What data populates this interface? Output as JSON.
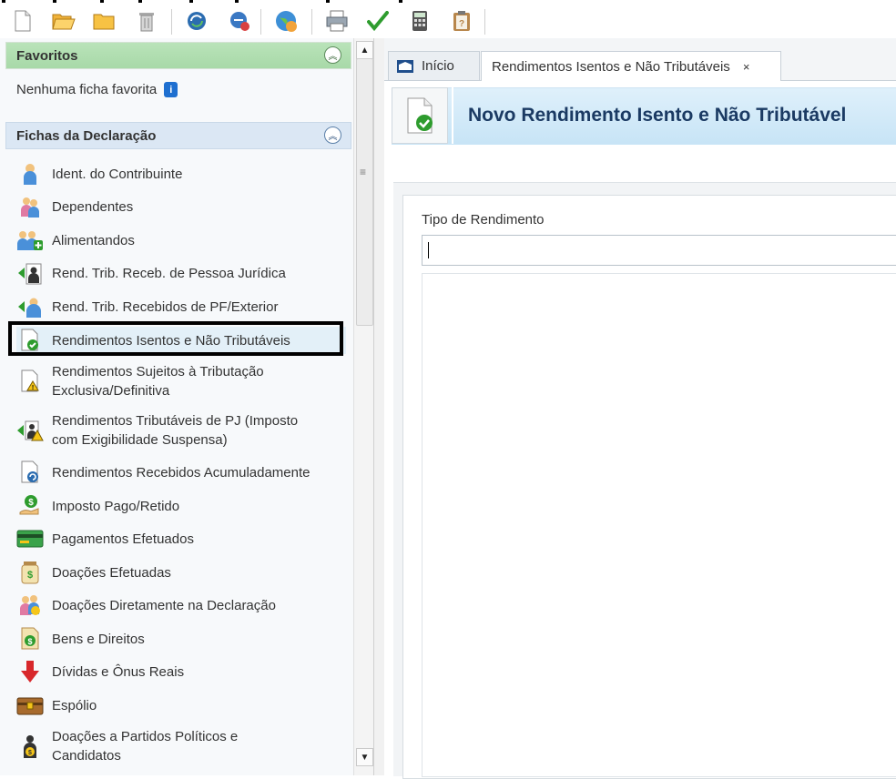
{
  "toolbar": {
    "buttons": [
      "new-file-icon",
      "open-folder-icon",
      "folder-icon",
      "trash-icon",
      "sync-icon",
      "recover-icon",
      "globe-icon",
      "print-icon",
      "check-icon",
      "calculator-icon",
      "clipboard-icon"
    ]
  },
  "sidebar": {
    "favoritos": {
      "title": "Favoritos",
      "empty_text": "Nenhuma ficha favorita"
    },
    "fichas": {
      "title": "Fichas da Declaração",
      "items": [
        {
          "label": "Ident. do Contribuinte",
          "icon": "person-icon"
        },
        {
          "label": "Dependentes",
          "icon": "dependents-icon"
        },
        {
          "label": "Alimentandos",
          "icon": "alimentandos-icon"
        },
        {
          "label": "Rend. Trib. Receb. de Pessoa Jurídica",
          "icon": "income-pj-icon"
        },
        {
          "label": "Rend. Trib. Recebidos de PF/Exterior",
          "icon": "income-pf-icon"
        },
        {
          "label": "Rendimentos Isentos e Não Tributáveis",
          "icon": "document-check-icon"
        },
        {
          "label_l1": "Rendimentos Sujeitos à Tributação",
          "label_l2": "Exclusiva/Definitiva",
          "icon": "document-warning-icon"
        },
        {
          "label_l1": "Rendimentos Tributáveis de PJ (Imposto",
          "label_l2": "com Exigibilidade Suspensa)",
          "icon": "income-suspended-icon"
        },
        {
          "label": "Rendimentos Recebidos Acumuladamente",
          "icon": "document-refresh-icon"
        },
        {
          "label": "Imposto Pago/Retido",
          "icon": "tax-paid-icon"
        },
        {
          "label": "Pagamentos Efetuados",
          "icon": "card-icon"
        },
        {
          "label": "Doações Efetuadas",
          "icon": "donation-jar-icon"
        },
        {
          "label": "Doações Diretamente na Declaração",
          "icon": "donation-people-icon"
        },
        {
          "label": "Bens e Direitos",
          "icon": "assets-icon"
        },
        {
          "label": "Dívidas e Ônus Reais",
          "icon": "debt-arrow-icon"
        },
        {
          "label": "Espólio",
          "icon": "chest-icon"
        },
        {
          "label_l1": "Doações a Partidos Políticos e",
          "label_l2": "Candidatos",
          "icon": "political-donation-icon"
        }
      ]
    }
  },
  "tabs": [
    {
      "label": "Início"
    },
    {
      "label": "Rendimentos Isentos e Não Tributáveis",
      "close": "×"
    }
  ],
  "form": {
    "title": "Novo Rendimento Isento e Não Tributável",
    "field_label": "Tipo de Rendimento",
    "field_value": ""
  }
}
